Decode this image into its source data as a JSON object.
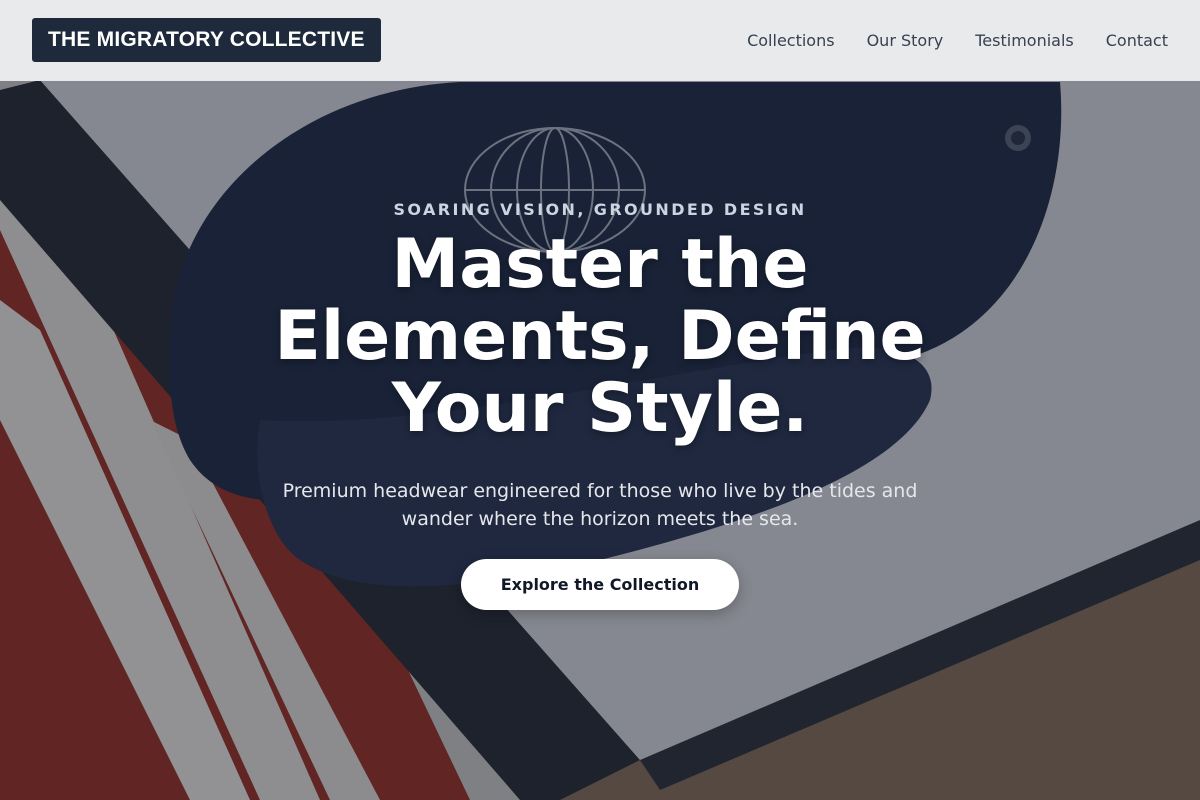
{
  "header": {
    "brand": "THE MIGRATORY COLLECTIVE",
    "nav": [
      {
        "label": "Collections"
      },
      {
        "label": "Our Story"
      },
      {
        "label": "Testimonials"
      },
      {
        "label": "Contact"
      }
    ]
  },
  "hero": {
    "eyebrow": "SOARING VISION, GROUNDED DESIGN",
    "title": "Master the Elements, Define Your Style.",
    "subtitle": "Premium headwear engineered for those who live by the tides and wander where the horizon meets the sea.",
    "cta_label": "Explore the Collection"
  },
  "colors": {
    "brand_bg": "#1e293b",
    "header_bg": "#f1f2f4",
    "cta_bg": "#ffffff",
    "hero_title": "#ffffff",
    "cap_navy": "#1f2a44"
  }
}
